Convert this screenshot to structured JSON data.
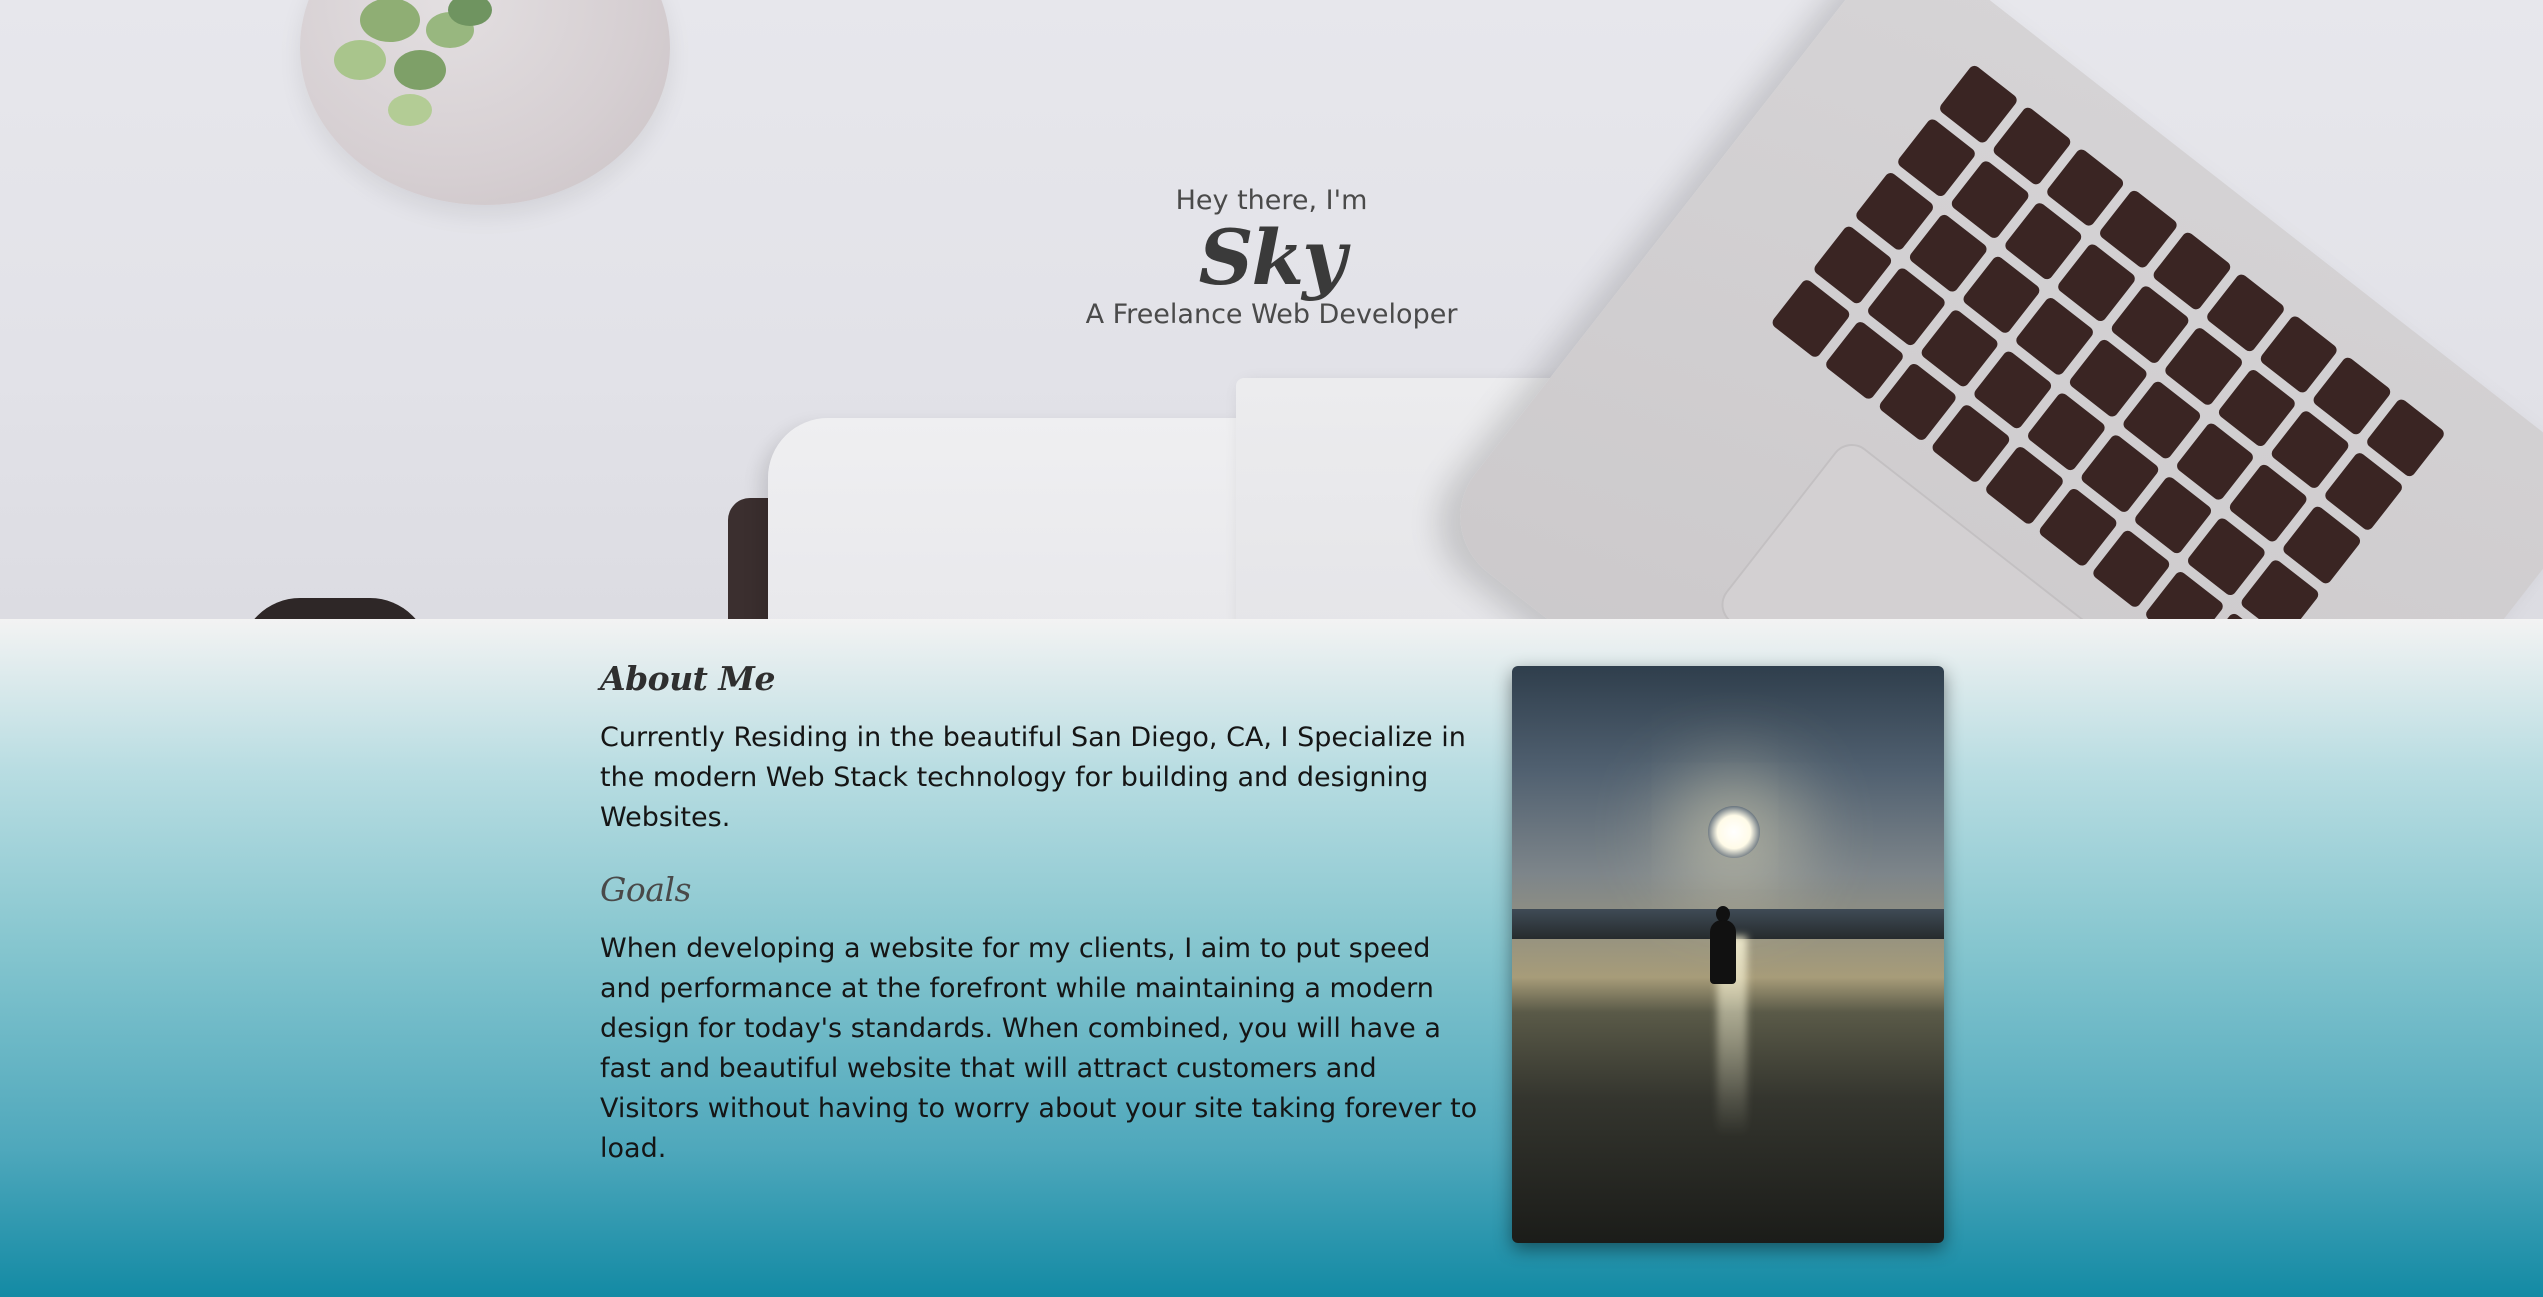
{
  "hero": {
    "greeting": "Hey there, I'm",
    "name": "Sky",
    "role": "A Freelance Web Developer"
  },
  "about": {
    "heading": "About Me",
    "text": "Currently Residing in the beautiful San Diego, CA, I Specialize in the modern Web Stack technology for building and designing Websites.",
    "goals_heading": "Goals",
    "goals_text": "When developing a website for my clients, I aim to put speed and performance at the forefront while maintaining a modern design for today's standards. When combined, you will have a fast and beautiful website that will attract customers and Visitors without having to worry about your site taking forever to load."
  },
  "colors": {
    "heading_text": "#2f2f2f",
    "body_text": "#151515",
    "gradient_top": "#f3f3f3",
    "gradient_bottom": "#138aa4"
  }
}
